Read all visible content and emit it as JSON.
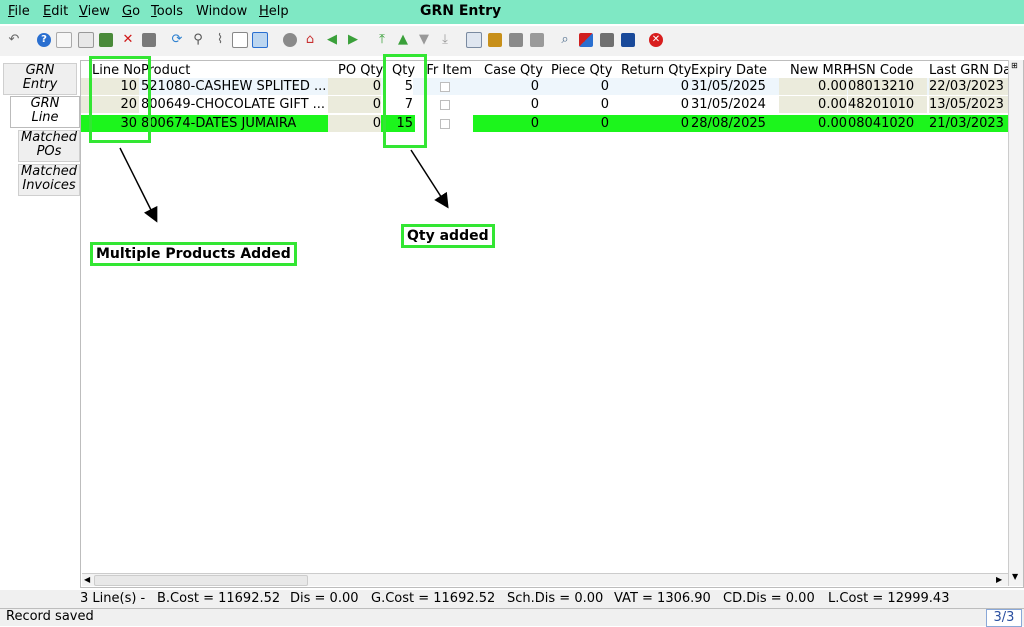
{
  "window": {
    "title": "GRN Entry"
  },
  "menu": [
    {
      "label": "File",
      "underline": "F",
      "rest": "ile"
    },
    {
      "label": "Edit",
      "underline": "E",
      "rest": "dit"
    },
    {
      "label": "View",
      "underline": "V",
      "rest": "iew"
    },
    {
      "label": "Go",
      "underline": "G",
      "rest": "o"
    },
    {
      "label": "Tools",
      "underline": "T",
      "rest": "ools"
    },
    {
      "label": "Window",
      "underline": "",
      "rest": "Window"
    },
    {
      "label": "Help",
      "underline": "H",
      "rest": "elp"
    }
  ],
  "toolbar_icons": [
    "undo-icon",
    "help-icon",
    "new-record-icon",
    "copy-icon",
    "save-icon",
    "delete-icon",
    "print-preview-icon",
    "refresh-icon",
    "find-icon",
    "attachment-icon",
    "multi-window-icon",
    "fullscreen-icon",
    "history-icon",
    "home-icon",
    "back-icon",
    "forward-icon",
    "first-record-icon",
    "previous-record-icon",
    "next-record-icon",
    "last-record-icon",
    "report-icon",
    "archive-icon",
    "print-icon",
    "print-setup-icon",
    "zoom-across-icon",
    "workflow-icon",
    "request-icon",
    "product-info-icon",
    "close-window-icon"
  ],
  "tabs": {
    "grn_entry": [
      "GRN",
      "Entry"
    ],
    "grn_line": [
      "GRN",
      "Line"
    ],
    "matched_pos": [
      "Matched",
      "POs"
    ],
    "matched_invoices": [
      "Matched",
      "Invoices"
    ]
  },
  "table": {
    "headers": {
      "line_no": "Line No",
      "product": "Product",
      "po_qty": "PO Qty",
      "qty": "Qty",
      "fr_item": "Fr Item",
      "case_qty": "Case Qty",
      "piece_qty": "Piece Qty",
      "return_qty": "Return Qty",
      "expiry_date": "Expiry Date",
      "new_mrp": "New MRP",
      "hsn_code": "HSN Code",
      "last_grn_date": "Last GRN Da"
    },
    "rows": [
      {
        "line_no": "10",
        "product": "521080-CASHEW SPLITED ...",
        "po_qty": "0",
        "qty": "5",
        "case_qty": "0",
        "piece_qty": "0",
        "return_qty": "0",
        "expiry_date": "31/05/2025",
        "new_mrp": "0.00",
        "hsn_code": "08013210",
        "last_grn_date": "22/03/2023"
      },
      {
        "line_no": "20",
        "product": "800649-CHOCOLATE GIFT ...",
        "po_qty": "0",
        "qty": "7",
        "case_qty": "0",
        "piece_qty": "0",
        "return_qty": "0",
        "expiry_date": "31/05/2024",
        "new_mrp": "0.00",
        "hsn_code": "48201010",
        "last_grn_date": "13/05/2023"
      },
      {
        "line_no": "30",
        "product": "800674-DATES JUMAIRA",
        "po_qty": "0",
        "qty": "15",
        "case_qty": "0",
        "piece_qty": "0",
        "return_qty": "0",
        "expiry_date": "28/08/2025",
        "new_mrp": "0.00",
        "hsn_code": "08041020",
        "last_grn_date": "21/03/2023"
      }
    ]
  },
  "annotations": {
    "products": "Multiple Products Added",
    "qty": "Qty added"
  },
  "summary": {
    "lines": "3 Line(s) -",
    "bcost": "B.Cost = 11692.52",
    "dis": "Dis = 0.00",
    "gcost": "G.Cost = 11692.52",
    "schdis": "Sch.Dis = 0.00",
    "vat": "VAT = 1306.90",
    "cddis": "CD.Dis = 0.00",
    "lcost": "L.Cost = 12999.43"
  },
  "status": {
    "message": "Record saved",
    "count": "3/3"
  },
  "colors": {
    "menubar": "#7fe8c4",
    "highlight_row": "#1cf51c",
    "annotation_border": "#33e633"
  }
}
